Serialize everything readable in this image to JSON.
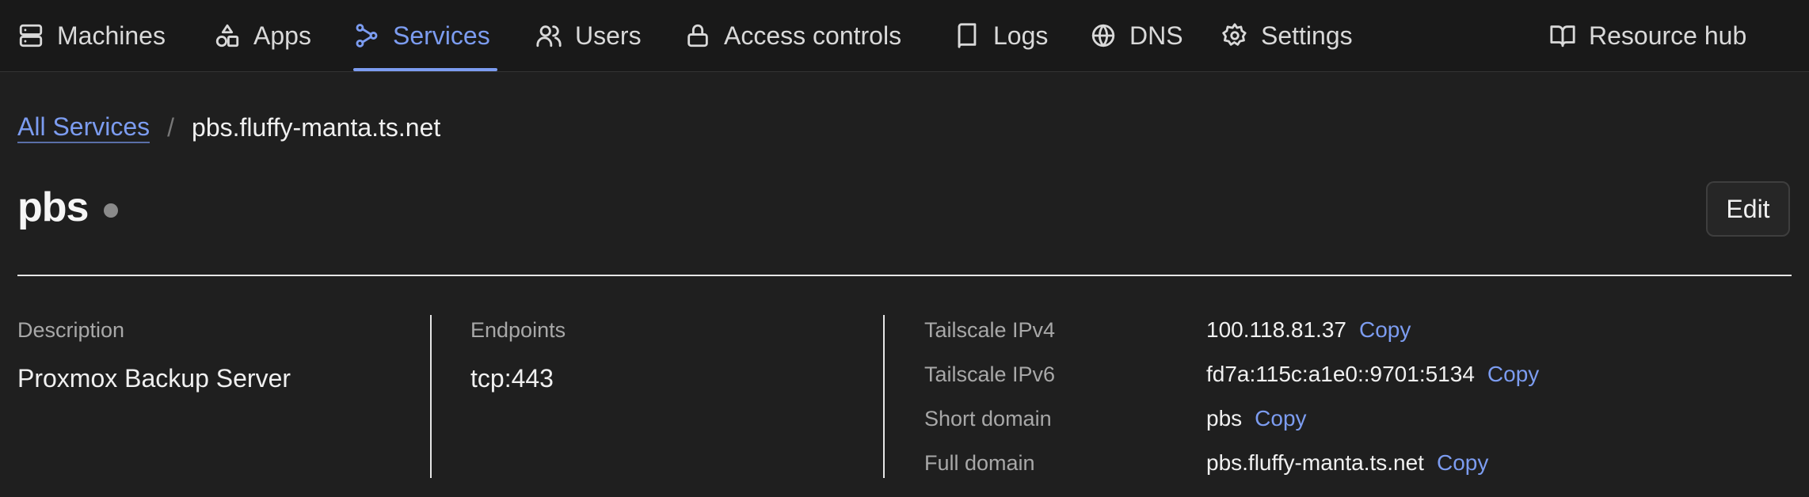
{
  "nav": {
    "items": [
      {
        "label": "Machines",
        "icon": "server-icon"
      },
      {
        "label": "Apps",
        "icon": "shapes-icon"
      },
      {
        "label": "Services",
        "icon": "services-icon",
        "active": true
      },
      {
        "label": "Users",
        "icon": "users-icon"
      },
      {
        "label": "Access controls",
        "icon": "lock-icon"
      },
      {
        "label": "Logs",
        "icon": "book-icon"
      },
      {
        "label": "DNS",
        "icon": "globe-icon"
      },
      {
        "label": "Settings",
        "icon": "gear-icon"
      }
    ],
    "resource_hub": {
      "label": "Resource hub",
      "icon": "open-book-icon"
    }
  },
  "breadcrumb": {
    "parent": "All Services",
    "separator": "/",
    "current": "pbs.fluffy-manta.ts.net"
  },
  "page": {
    "title": "pbs",
    "edit_label": "Edit"
  },
  "details": {
    "description": {
      "label": "Description",
      "value": "Proxmox Backup Server"
    },
    "endpoints": {
      "label": "Endpoints",
      "value": "tcp:443"
    },
    "properties": [
      {
        "label": "Tailscale IPv4",
        "value": "100.118.81.37",
        "action": "Copy"
      },
      {
        "label": "Tailscale IPv6",
        "value": "fd7a:115c:a1e0::9701:5134",
        "action": "Copy"
      },
      {
        "label": "Short domain",
        "value": "pbs",
        "action": "Copy"
      },
      {
        "label": "Full domain",
        "value": "pbs.fluffy-manta.ts.net",
        "action": "Copy"
      }
    ]
  },
  "colors": {
    "accent": "#7c9cf0",
    "background": "#1f1f1f",
    "nav_background": "#191919",
    "status_dot": "#8a8a8a"
  }
}
